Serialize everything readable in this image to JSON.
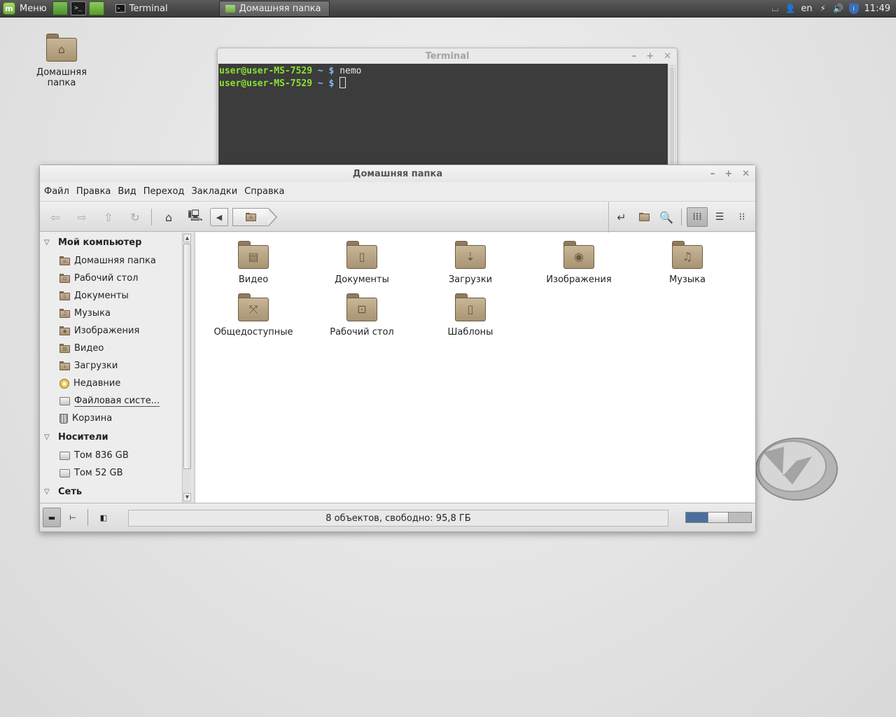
{
  "panel": {
    "menu_label": "Меню",
    "tasks": [
      {
        "label": "Terminal"
      },
      {
        "label": "Домашняя папка"
      }
    ],
    "keyboard_layout": "en",
    "clock": "11:49"
  },
  "desktop": {
    "icon_label": "Домашняя папка"
  },
  "terminal": {
    "title": "Terminal",
    "lines": [
      {
        "user": "user@user-MS-7529",
        "path": "~ $",
        "command": "nemo"
      },
      {
        "user": "user@user-MS-7529",
        "path": "~ $",
        "command": ""
      }
    ]
  },
  "nemo": {
    "title": "Домашняя папка",
    "menu": [
      "Файл",
      "Правка",
      "Вид",
      "Переход",
      "Закладки",
      "Справка"
    ],
    "sidebar": {
      "sections": [
        {
          "title": "Мой компьютер",
          "items": [
            {
              "label": "Домашняя папка",
              "icon": "home-folder-icon"
            },
            {
              "label": "Рабочий стол",
              "icon": "desktop-folder-icon"
            },
            {
              "label": "Документы",
              "icon": "documents-folder-icon"
            },
            {
              "label": "Музыка",
              "icon": "music-folder-icon"
            },
            {
              "label": "Изображения",
              "icon": "pictures-folder-icon"
            },
            {
              "label": "Видео",
              "icon": "video-folder-icon"
            },
            {
              "label": "Загрузки",
              "icon": "downloads-folder-icon"
            },
            {
              "label": "Недавние",
              "icon": "recent-icon"
            },
            {
              "label": "Файловая систе...",
              "icon": "drive-icon"
            },
            {
              "label": "Корзина",
              "icon": "trash-icon"
            }
          ]
        },
        {
          "title": "Носители",
          "items": [
            {
              "label": "Том 836 GB",
              "icon": "drive-icon"
            },
            {
              "label": "Том 52 GB",
              "icon": "drive-icon"
            }
          ]
        },
        {
          "title": "Сеть",
          "items": []
        }
      ]
    },
    "items": [
      {
        "label": "Видео",
        "icon": "video-folder-icon",
        "glyph": "▤"
      },
      {
        "label": "Документы",
        "icon": "documents-folder-icon",
        "glyph": "▯"
      },
      {
        "label": "Загрузки",
        "icon": "downloads-folder-icon",
        "glyph": "⇣"
      },
      {
        "label": "Изображения",
        "icon": "pictures-folder-icon",
        "glyph": "◉"
      },
      {
        "label": "Музыка",
        "icon": "music-folder-icon",
        "glyph": "♫"
      },
      {
        "label": "Общедоступные",
        "icon": "public-folder-icon",
        "glyph": "⤧"
      },
      {
        "label": "Рабочий стол",
        "icon": "desktop-folder-icon",
        "glyph": "⊡"
      },
      {
        "label": "Шаблоны",
        "icon": "templates-folder-icon",
        "glyph": "▯"
      }
    ],
    "status": "8 объектов, свободно: 95,8 ГБ",
    "zoom_fraction": 0.33
  },
  "colors": {
    "prompt_user": "#8ae234",
    "prompt_path": "#8ab4f8",
    "folder": "#b9a581",
    "zoom_fill": "#4a6f9e"
  }
}
